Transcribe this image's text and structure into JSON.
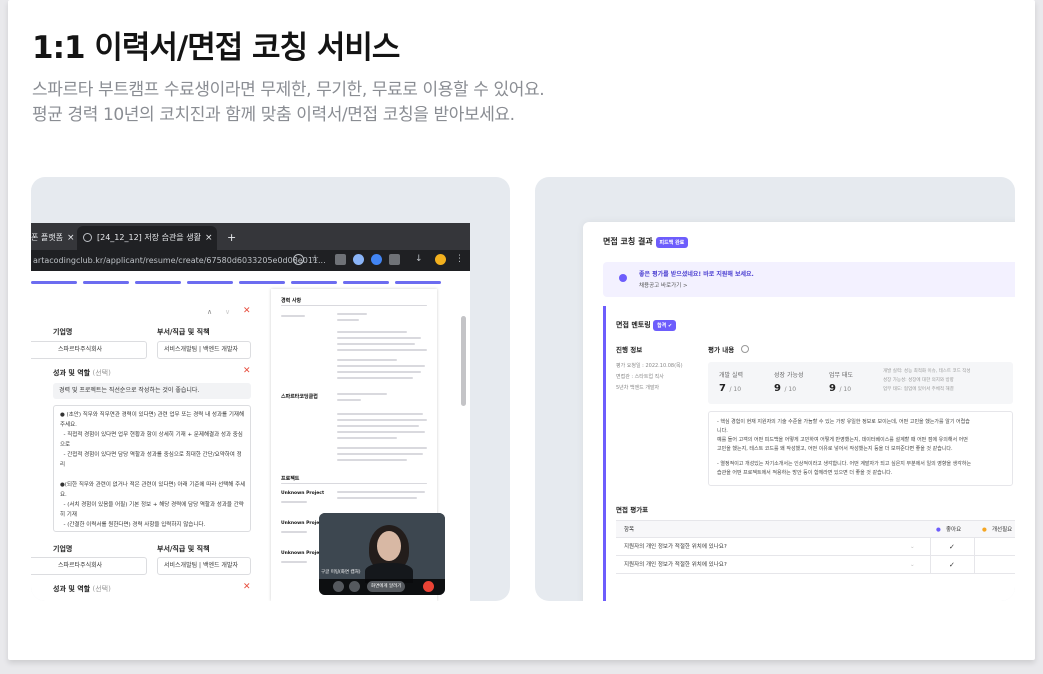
{
  "header": {
    "title": "1:1 이력서/면접 코칭 서비스",
    "subtitle_line1": "스파르타 부트캠프 수료생이라면 무제한, 무기한, 무료로 이용할 수 있어요.",
    "subtitle_line2": "평균 경력 10년의 코치진과 함께 맞춤 이력서/면접 코칭을 받아보세요."
  },
  "resume_screen": {
    "browser": {
      "tab1": "폰 플랫폼",
      "tab2": "[24_12_12] 저장 습관을 생활화 하",
      "new_tab": "+",
      "close": "×",
      "url": "artacodingclub.kr/applicant/resume/create/67580d6033205e0d08e011..."
    },
    "form": {
      "company_label": "기업명",
      "position_label": "부서/직급 및 직책",
      "company_value": "스파르타주식회사",
      "position_value": "서비스개발팀 | 백엔드 개발자",
      "achievement_label": "성과 및 역할",
      "optional": "(선택)",
      "hint": "경력 및 프로젝트는 직선순으로 작성하는 것이 좋습니다.",
      "desc": "● (초안) 직무와 직무연관 경력이 있다면) 관련 업무 또는 경력 내 성과를 기재해\n주세요.\n  - 직접적 경험이 있다면 업무 현황과 함이 상세히 기재 + 문제해결과 성과 중심\n으로\n  - 간접적 경험이 있다면 담당 역할과 성과를 중심으로 최대한 간단/요약하여 정\n리\n\n●(되한 직무와 관련이 없거나 적은 관련이 있다면) 아래 기준에 따라 선택해 주세\n요.\n  - (서치 경험이 있음을 어필) 기본 정보 + 해당 경력에 담당 역할과 성과을 간략\n히 기재\n  - (간결한 이력서를 원한다면) 경력 사항을 입력하지 않습니다.",
      "company_label2": "기업명",
      "position_label2": "부서/직급 및 직책",
      "company_value2": "스파르타주식회사",
      "position_value2": "서비스개발팀 | 백엔드 개발자",
      "achievement_label2": "성과 및 역할",
      "optional2": "(선택)"
    },
    "resume_preview": {
      "sec1": "경력 사항",
      "sec2": "스파르타코딩클럽",
      "sec3": "프로젝트",
      "proj1": "Unknown Project",
      "proj2": "Unknown Project",
      "proj3": "Unknown Project"
    },
    "video": {
      "caption": "구글 미팅(화면 캡처)",
      "button": "화면에게 알려기"
    }
  },
  "coaching_screen": {
    "title": "면접 코칭 결과",
    "badge": "피드백 완료",
    "notice_title": "좋은 평가를 받으셨네요! 바로 지원해 보세요.",
    "notice_link": "채용공고 바로가기 >",
    "mentoring_title": "면접 멘토링",
    "mentoring_badge": "합격 ✔",
    "progress_label": "진행 정보",
    "progress_line1": "평가 요청일 : 2022.10.08(목)",
    "progress_line2": "면접관 : 스타트업 직사",
    "progress_line3": "5년차 백엔드 개발자",
    "eval_label": "평가 내용",
    "scores": [
      {
        "label": "개발 실력",
        "value": "7",
        "max": "/ 10"
      },
      {
        "label": "성장 가능성",
        "value": "9",
        "max": "/ 10"
      },
      {
        "label": "업무 태도",
        "value": "9",
        "max": "/ 10"
      }
    ],
    "score_note1": "개발 실력: 성능 최적화 이슈, 테스트 코드 작성",
    "score_note2": "성장 가능성: 성장에 대한 의지와 방향",
    "score_note3": "업무 태도: 협업에 있어서 주체적 해결",
    "feedback1": "- 핵심 경험이 현재 지원자의 기술 수준을 가늠할 수 있는 가장 유일한 정보로 보이는데, 어떤 고민을 했는가를 알기 어렵습",
    "feedback2": "니다.",
    "feedback3": "예를 들어 고객의 어떤 피드백을 어떻게 고민하여 어떻게 반영했는지, 데이터베이스를 설계할 때 어떤 점에 유의해서 어떤",
    "feedback4": "고민을 했는지, 테스트 코드를 왜 작성했고, 어떤 이유로 넣어서 작성했는지 등을 더 보여준다면 좋을 것 같습니다.",
    "feedback5": "- 열정적이고 개성있는 자기소개서는 인상적이라고 생각합니다. 어떤 계발자가 되고 싶은지 부분에서 일의 영향을 생각하는",
    "feedback6": "습관을 어떤 프로젝트에서 적용하는 방안 등이 함께라면 있으면 더 좋을 것 같습니다.",
    "table_title": "면접 평가표",
    "col_item": "항목",
    "col_good": "좋아요",
    "col_improve": "개선필요",
    "rows": [
      "지원자의 개인 정보가 적절한 위치에 있나요?",
      "지원자의 개인 정보가 적절한 위치에 있나요?"
    ],
    "check": "✓"
  },
  "colors": {
    "accent": "#6d5dfc",
    "panel_bg": "#e6eaef"
  }
}
